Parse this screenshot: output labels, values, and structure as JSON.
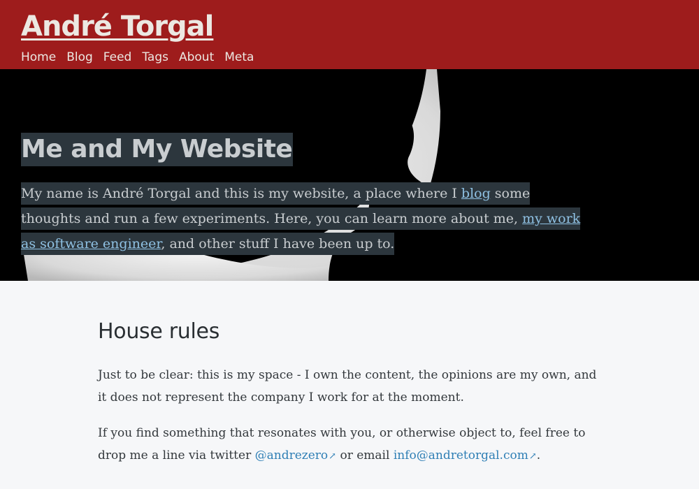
{
  "header": {
    "site_title": "André Torgal",
    "nav": [
      {
        "label": "Home"
      },
      {
        "label": "Blog"
      },
      {
        "label": "Feed"
      },
      {
        "label": "Tags"
      },
      {
        "label": "About"
      },
      {
        "label": "Meta"
      }
    ]
  },
  "hero": {
    "title": "Me and My Website",
    "intro": {
      "t1": "My name is André Torgal and this is my website, a place where I ",
      "link_blog": "blog",
      "t2": " some thoughts and run a few experiments. Here, you can learn more about me, ",
      "link_work": "my work as software engineer",
      "t3": ", and other stuff I have been up to."
    },
    "image": "silhouette-crescent-moon"
  },
  "main": {
    "section_title": "House rules",
    "paragraph1": "Just to be clear: this is my space - I own the content, the opinions are my own, and it does not represent the company I work for at the moment.",
    "paragraph2": {
      "t1": "If you find something that resonates with you, or otherwise object to, feel free to drop me a line via twitter ",
      "twitter_link": "@andrezero",
      "t2": " or email ",
      "email_link": "info@andretorgal.com",
      "t3": "."
    },
    "external_link_icon": "↗"
  },
  "colors": {
    "header_bg": "#9e1c1c",
    "header_text": "#ece8e2",
    "hero_bg": "#000000",
    "hero_highlight": "#2c363d",
    "hero_link": "#8fc1e3",
    "page_bg": "#f6f7f9",
    "body_text": "#33383c",
    "link": "#2f7fb5"
  }
}
